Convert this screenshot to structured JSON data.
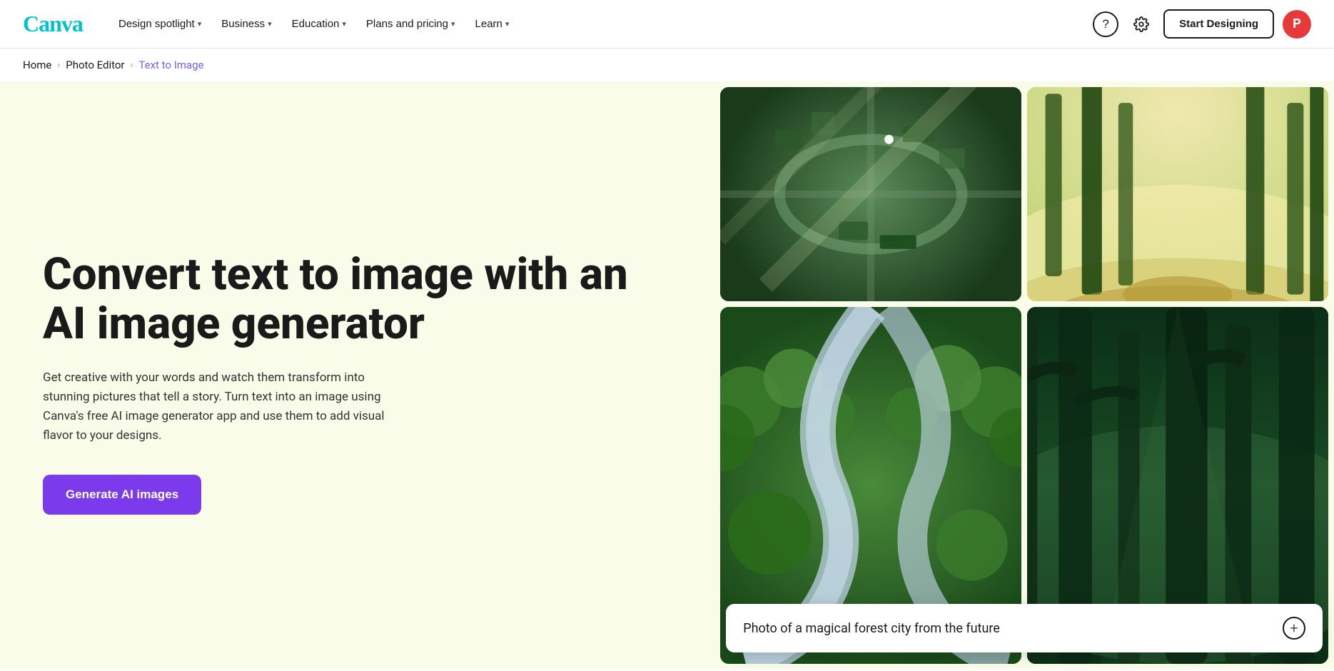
{
  "nav": {
    "logo_text": "Canva",
    "links": [
      {
        "label": "Design spotlight",
        "has_dropdown": true
      },
      {
        "label": "Business",
        "has_dropdown": true
      },
      {
        "label": "Education",
        "has_dropdown": true
      },
      {
        "label": "Plans and pricing",
        "has_dropdown": true
      },
      {
        "label": "Learn",
        "has_dropdown": true
      }
    ],
    "help_icon": "?",
    "settings_icon": "⚙",
    "start_designing_label": "Start Designing",
    "user_initial": "P"
  },
  "breadcrumb": {
    "home": "Home",
    "photo_editor": "Photo Editor",
    "current": "Text to Image"
  },
  "hero": {
    "title": "Convert text to image with an AI image generator",
    "subtitle": "Get creative with your words and watch them transform into stunning pictures that tell a story. Turn text into an image using Canva's free AI image generator app and use them to add visual flavor to your designs.",
    "cta_label": "Generate AI images"
  },
  "prompt_overlay": {
    "text": "Photo of a magical forest city from the future",
    "plus_label": "+"
  },
  "images": {
    "alt_1": "aerial city with green rooftops",
    "alt_2": "misty magical forest",
    "alt_3": "winding river through forest",
    "alt_4": "tall ancient trees"
  }
}
